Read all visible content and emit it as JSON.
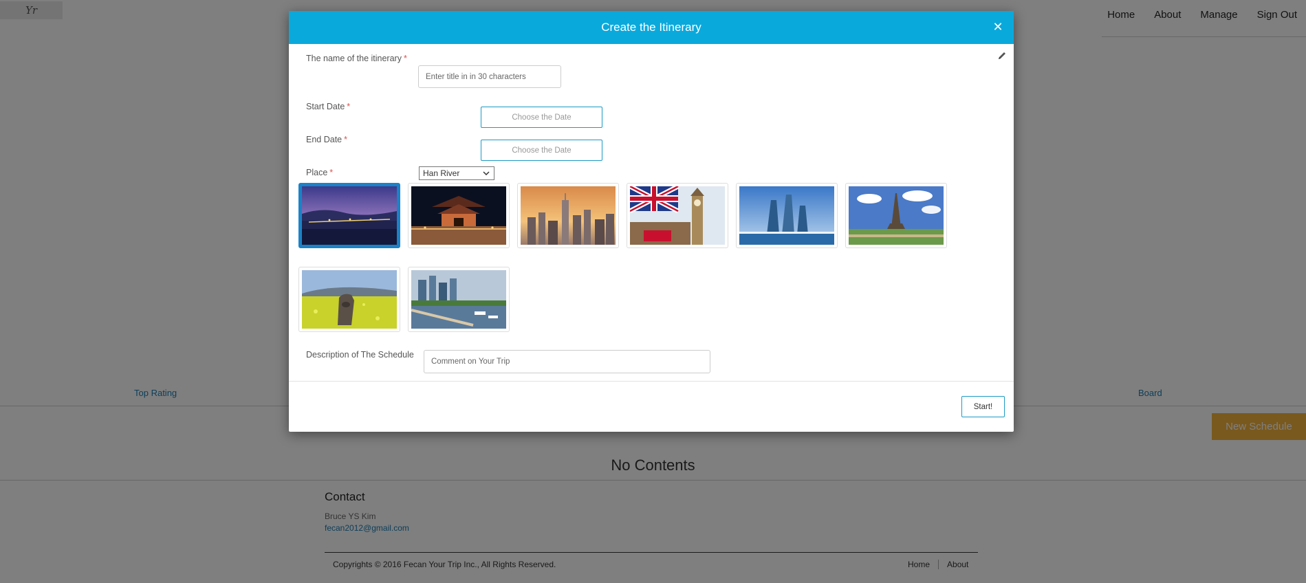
{
  "logo": {
    "text": "Yr"
  },
  "nav": {
    "items": [
      "Home",
      "About",
      "Manage",
      "Sign Out"
    ]
  },
  "tabs": {
    "left": "Top Rating",
    "right": "Board"
  },
  "new_schedule_label": "New Schedule",
  "no_contents": "No Contents",
  "contact": {
    "title": "Contact",
    "name": "Bruce YS Kim",
    "email": "fecan2012@gmail.com"
  },
  "footer": {
    "copyright": "Copyrights © 2016 Fecan Your Trip Inc., All Rights Reserved.",
    "links": [
      "Home",
      "About"
    ]
  },
  "modal": {
    "title": "Create the Itinerary",
    "close_icon": "close-icon",
    "edit_icon": "pencil-icon",
    "name_label": "The name of the itinerary",
    "name_placeholder": "Enter title in in 30 characters",
    "start_label": "Start Date",
    "end_label": "End Date",
    "date_button": "Choose the Date",
    "place_label": "Place",
    "place_selected": "Han River",
    "required_mark": "*",
    "places": [
      {
        "scene": "han-river-night",
        "selected": true
      },
      {
        "scene": "palace-gate-night",
        "selected": false
      },
      {
        "scene": "new-york-skyline",
        "selected": false
      },
      {
        "scene": "big-ben-union-jack",
        "selected": false
      },
      {
        "scene": "busan-towers",
        "selected": false
      },
      {
        "scene": "eiffel-tower",
        "selected": false
      },
      {
        "scene": "jeju-stone-statue",
        "selected": false
      },
      {
        "scene": "vancouver-harbor",
        "selected": false
      }
    ],
    "description_label": "Description of The Schedule",
    "description_placeholder": "Comment on Your Trip",
    "start_button": "Start!"
  },
  "colors": {
    "header": "#0aa9dc",
    "accent": "#1a9bc4",
    "selected_border": "#1a82c8",
    "new_schedule": "#f2b33d",
    "link": "#1a7db3"
  }
}
